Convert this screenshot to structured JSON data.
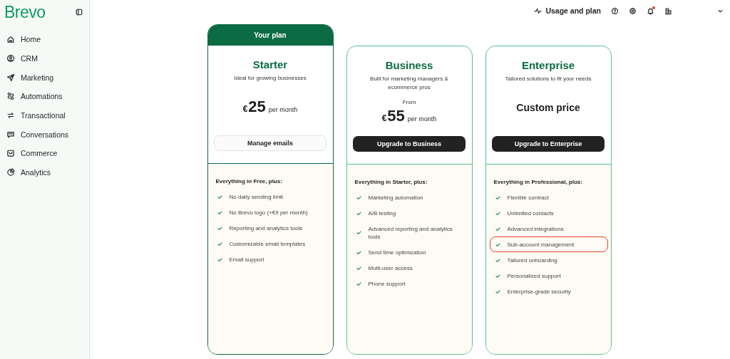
{
  "sidebar": {
    "logo": "Brevo",
    "items": [
      {
        "label": "Home"
      },
      {
        "label": "CRM"
      },
      {
        "label": "Marketing"
      },
      {
        "label": "Automations"
      },
      {
        "label": "Transactional"
      },
      {
        "label": "Conversations"
      },
      {
        "label": "Commerce"
      },
      {
        "label": "Analytics"
      }
    ]
  },
  "topbar": {
    "usage_label": "Usage and plan",
    "notification_unread": true
  },
  "plans": [
    {
      "current": true,
      "badge": "Your plan",
      "name": "Starter",
      "tagline": "Ideal for growing businesses",
      "currency": "€",
      "amount": "25",
      "period": "per month",
      "button": {
        "label": "Manage emails",
        "kind": "secondary"
      },
      "features_title": "Everything in Free, plus:",
      "features": [
        {
          "text": "No daily sending limit",
          "highlighted": false
        },
        {
          "text": "No Brevo logo (+€9 per month)",
          "highlighted": false
        },
        {
          "text": "Reporting and analytics tools",
          "highlighted": false
        },
        {
          "text": "Customizable email templates",
          "highlighted": false
        },
        {
          "text": "Email support",
          "highlighted": false
        }
      ]
    },
    {
      "current": false,
      "name": "Business",
      "tagline": "Built for marketing managers & ecommerce pros",
      "price_prefix": "From",
      "currency": "€",
      "amount": "55",
      "period": "per month",
      "button": {
        "label": "Upgrade to Business",
        "kind": "primary"
      },
      "features_title": "Everything in Starter, plus:",
      "features": [
        {
          "text": "Marketing automation",
          "highlighted": false
        },
        {
          "text": "A/B testing",
          "highlighted": false
        },
        {
          "text": "Advanced reporting and analytics tools",
          "highlighted": false
        },
        {
          "text": "Send time optimization",
          "highlighted": false
        },
        {
          "text": "Multi-user access",
          "highlighted": false
        },
        {
          "text": "Phone support",
          "highlighted": false
        }
      ]
    },
    {
      "current": false,
      "name": "Enterprise",
      "tagline": "Tailored solutions to fit your needs",
      "custom_price": "Custom price",
      "button": {
        "label": "Upgrade to Enterprise",
        "kind": "primary"
      },
      "features_title": "Everything in Professional, plus:",
      "features": [
        {
          "text": "Flexible contract",
          "highlighted": false
        },
        {
          "text": "Unlimited contacts",
          "highlighted": false
        },
        {
          "text": "Advanced integrations",
          "highlighted": false
        },
        {
          "text": "Sub-account management",
          "highlighted": true
        },
        {
          "text": "Tailored onboarding",
          "highlighted": false
        },
        {
          "text": "Personalized support",
          "highlighted": false
        },
        {
          "text": "Enterprise-grade security",
          "highlighted": false
        }
      ]
    }
  ]
}
